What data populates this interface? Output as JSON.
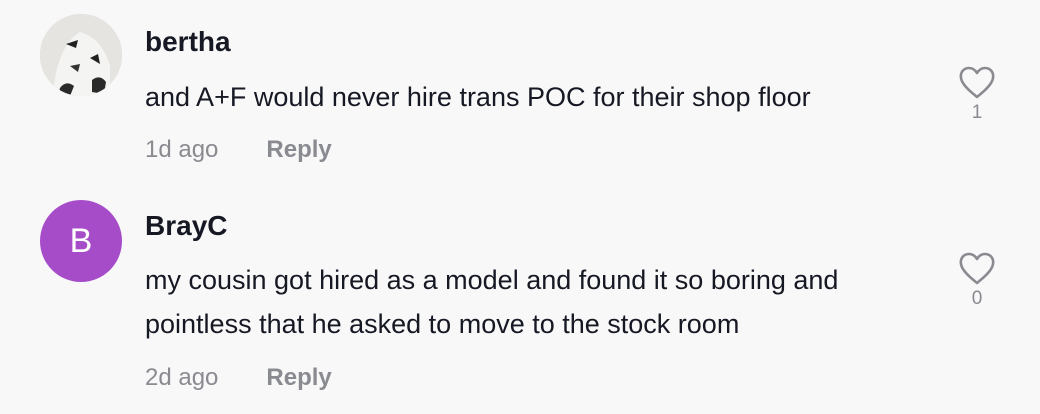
{
  "comments": [
    {
      "username": "bertha",
      "text": "and A+F would never hire trans POC for their shop floor",
      "time": "1d ago",
      "reply_label": "Reply",
      "like_count": "1",
      "avatar_type": "photo"
    },
    {
      "username": "BrayC",
      "text": "my cousin got hired as a model and found it so boring and pointless that he asked to move to the stock room",
      "time": "2d ago",
      "reply_label": "Reply",
      "like_count": "0",
      "avatar_type": "letter",
      "avatar_letter": "B",
      "avatar_color": "#a74cc8"
    }
  ],
  "icons": {
    "like": "heart-outline-icon"
  },
  "colors": {
    "background": "#f8f8f8",
    "text": "#161823",
    "muted": "#8a8b91"
  }
}
